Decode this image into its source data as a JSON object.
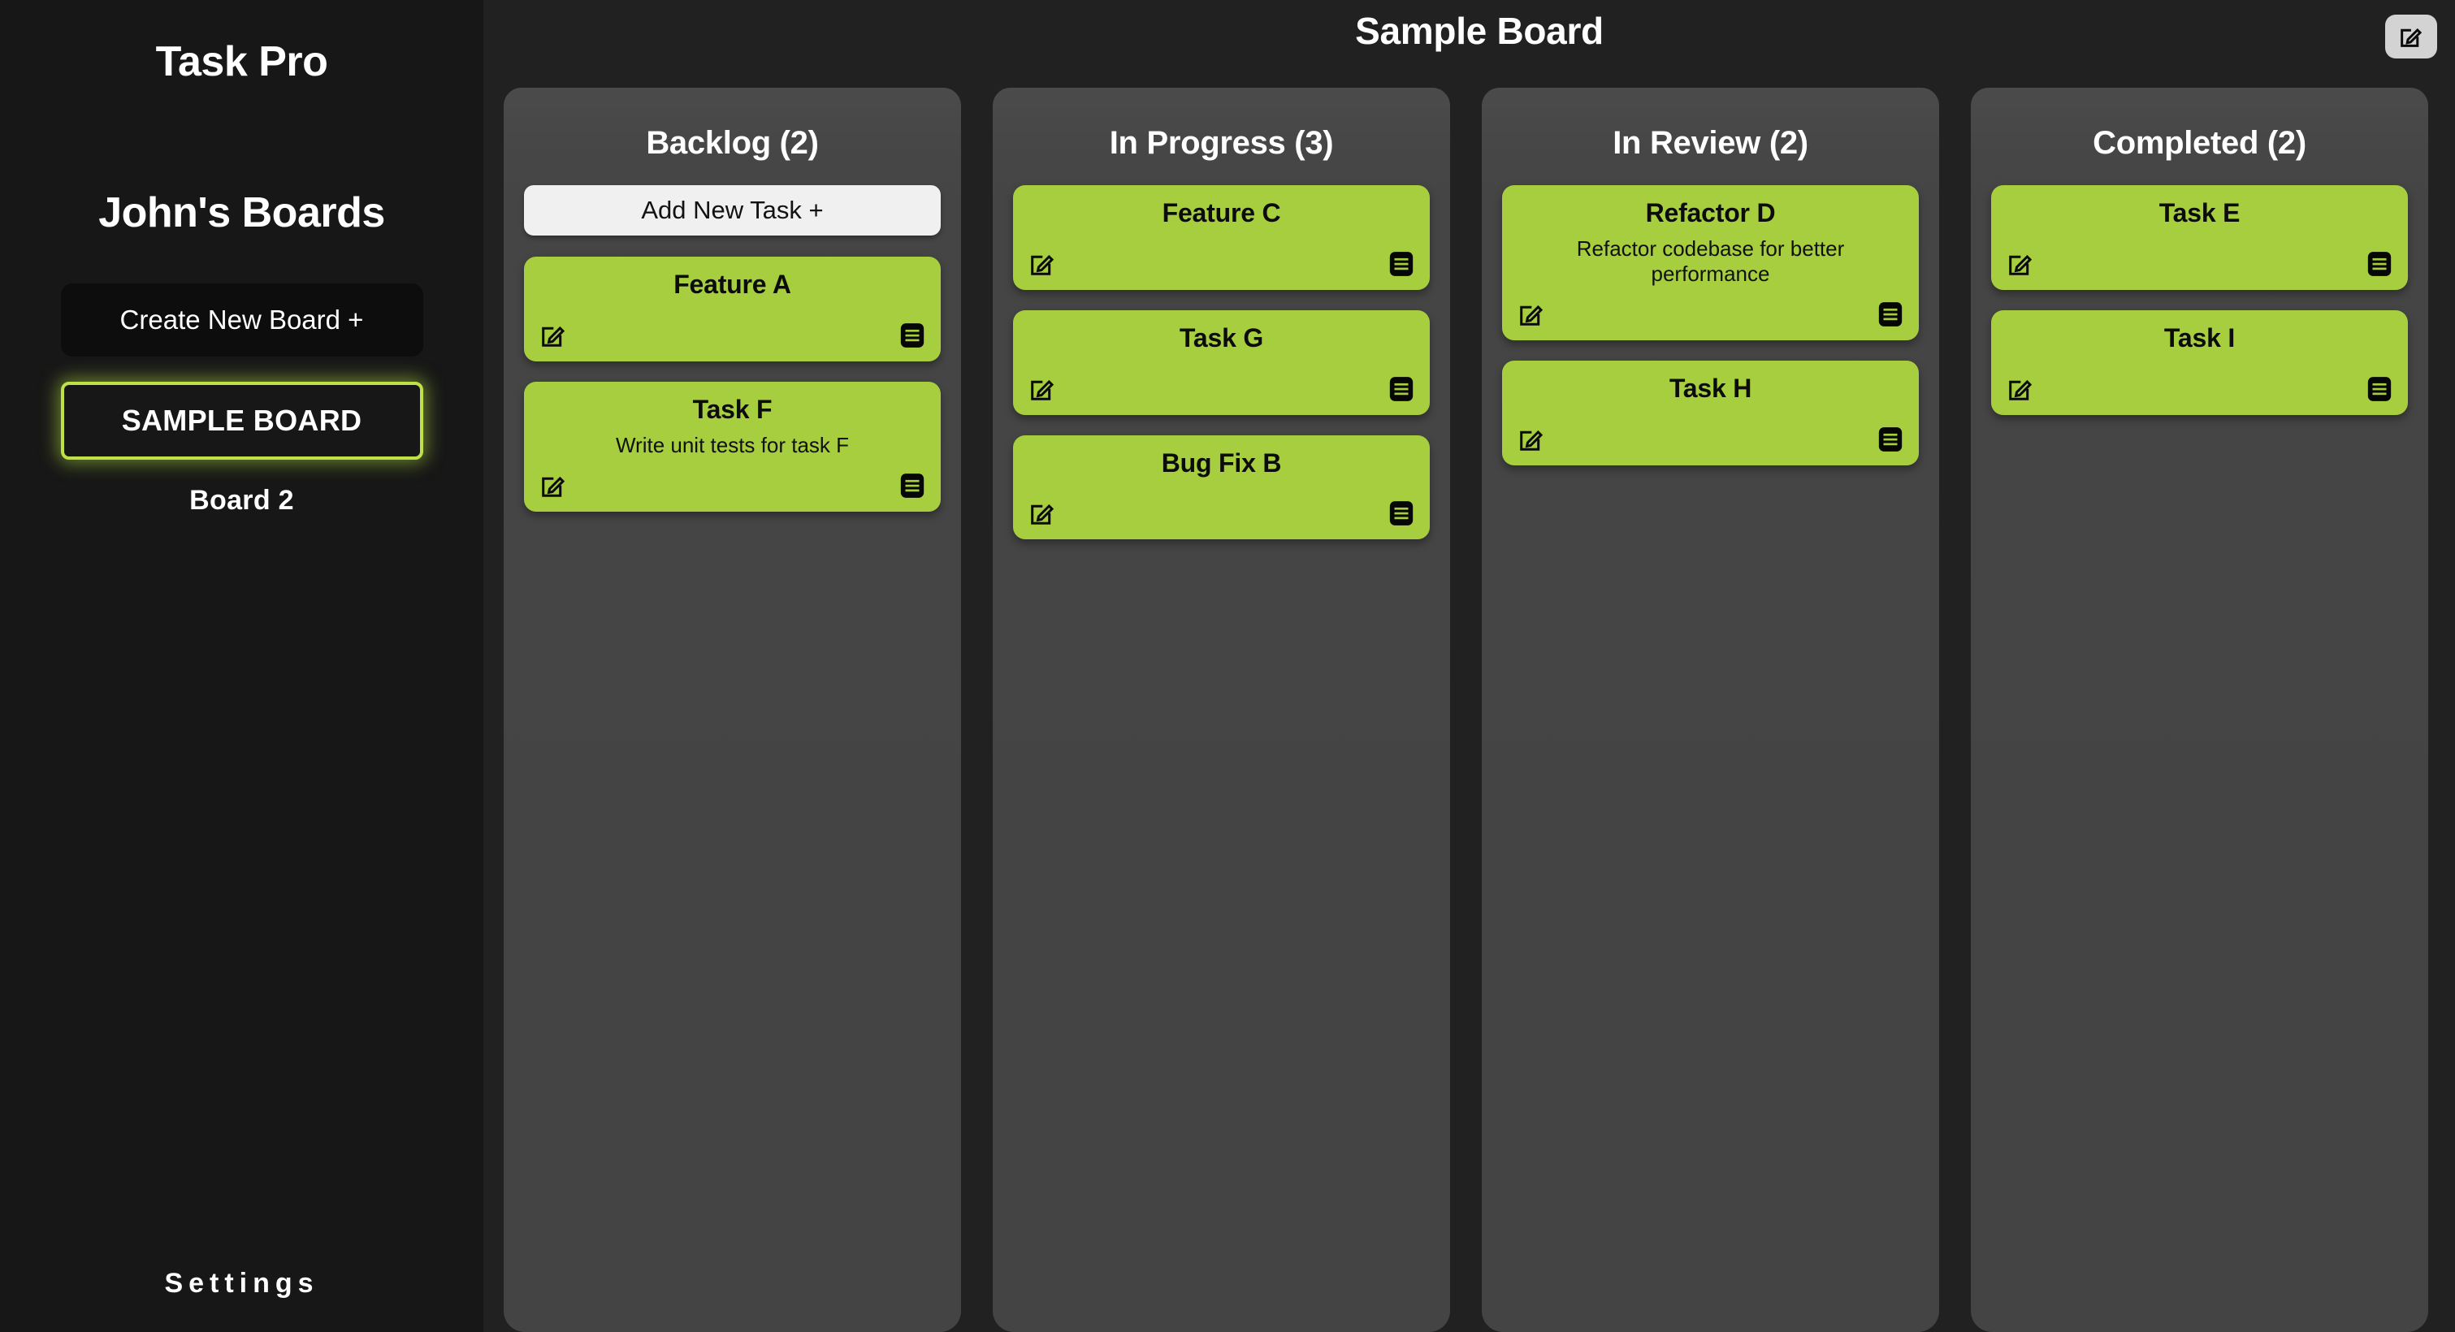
{
  "sidebar": {
    "app_title": "Task Pro",
    "boards_heading": "John's Boards",
    "create_board_label": "Create New Board +",
    "boards": [
      {
        "label": "SAMPLE BOARD",
        "active": true
      },
      {
        "label": "Board 2",
        "active": false
      }
    ],
    "settings_label": "Settings"
  },
  "header": {
    "board_title": "Sample Board",
    "edit_icon": "edit-square-icon"
  },
  "board": {
    "add_task_label": "Add New Task +",
    "card_edit_icon": "edit-square-icon",
    "card_menu_icon": "list-menu-icon",
    "columns": [
      {
        "title": "Backlog (2)",
        "count": 2,
        "has_add_button": true,
        "cards": [
          {
            "title": "Feature A",
            "description": ""
          },
          {
            "title": "Task F",
            "description": "Write unit tests for task F"
          }
        ]
      },
      {
        "title": "In Progress (3)",
        "count": 3,
        "has_add_button": false,
        "cards": [
          {
            "title": "Feature C",
            "description": ""
          },
          {
            "title": "Task G",
            "description": ""
          },
          {
            "title": "Bug Fix B",
            "description": ""
          }
        ]
      },
      {
        "title": "In Review (2)",
        "count": 2,
        "has_add_button": false,
        "cards": [
          {
            "title": "Refactor D",
            "description": "Refactor codebase for better performance"
          },
          {
            "title": "Task H",
            "description": ""
          }
        ]
      },
      {
        "title": "Completed (2)",
        "count": 2,
        "has_add_button": false,
        "cards": [
          {
            "title": "Task E",
            "description": ""
          },
          {
            "title": "Task I",
            "description": ""
          }
        ]
      }
    ]
  },
  "colors": {
    "accent_green": "#a6ce3e",
    "accent_glow": "#bfe048",
    "sidebar_bg": "#171717",
    "main_bg": "#212121",
    "column_bg": "#454545",
    "add_button_bg": "#f0f0f0",
    "edit_button_bg": "#d3d3d3"
  }
}
